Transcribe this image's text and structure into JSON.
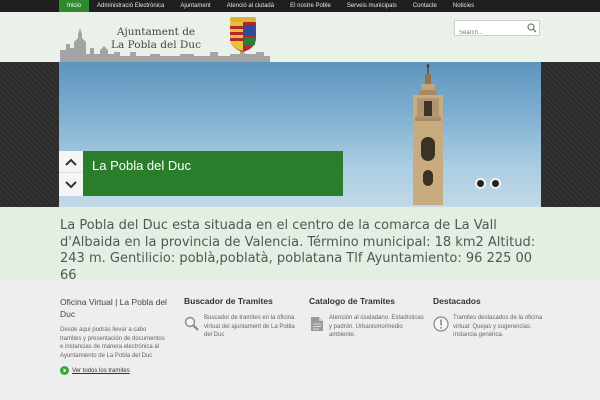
{
  "nav": {
    "items": [
      {
        "label": "Inicio",
        "active": true
      },
      {
        "label": "Administració Electrònica"
      },
      {
        "label": "Ajuntament"
      },
      {
        "label": "Atenció al ciutadà"
      },
      {
        "label": "El nostre Poble"
      },
      {
        "label": "Serveis municipals"
      },
      {
        "label": "Contacte"
      },
      {
        "label": "Noticies"
      }
    ]
  },
  "header": {
    "logo_line1": "Ajuntament de",
    "logo_line2": "La Pobla del Duc",
    "search_placeholder": "Search..."
  },
  "slider": {
    "caption": "La Pobla del Duc",
    "up_icon": "chevron-up-icon",
    "down_icon": "chevron-down-icon",
    "slides": 2,
    "current": 1
  },
  "intro": {
    "text": "La Pobla del Duc esta situada en el centro de la comarca de La Vall d'Albaida en la provincia de Valencia. Término municipal: 18 km2 Altitud: 243 m. Gentilicio: poblà,poblatà, poblatana Tlf Ayuntamiento: 96 225 00 66"
  },
  "columns": [
    {
      "title": "Oficina Virtual | La Pobla del Duc",
      "text": "Desde aquí podrás llevar a cabo tramites y presentación de documentos e instancias de manera electrónica al Ayuntamiento de La Pobla del Duc",
      "link": "Ver todos los tramites"
    },
    {
      "title": "Buscador de Tramites",
      "icon": "magnifier-icon",
      "text": "Buscador de tramites en la oficina virtual del ajuntament de La Pobla del Duc"
    },
    {
      "title": "Catalogo de Tramites",
      "icon": "document-icon",
      "text": "Atención al ciudadano. Estadísticas y padrón. Urbanismo/medio ambiente."
    },
    {
      "title": "Destacados",
      "icon": "alert-icon",
      "text": "Tramites destacados de la oficina virtual: Quejas y sugerencias. Instancia genérica."
    }
  ],
  "colors": {
    "accent_green": "#2a7d2a",
    "nav_active": "#2f8a2f",
    "nav_bg": "#1f1f1f"
  }
}
